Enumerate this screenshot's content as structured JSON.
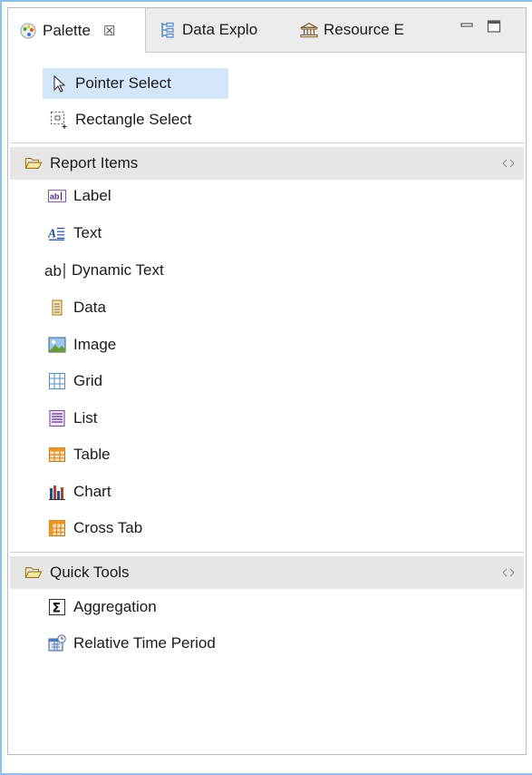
{
  "tabs": [
    {
      "label": "Palette",
      "icon": "palette-icon",
      "active": true,
      "close": "☒"
    },
    {
      "label": "Data Explo",
      "icon": "data-explorer-icon"
    },
    {
      "label": "Resource E",
      "icon": "resource-explorer-icon"
    }
  ],
  "window_controls": {
    "minimize": "minimize-icon",
    "maximize": "maximize-icon"
  },
  "tools": [
    {
      "label": "Pointer Select",
      "icon": "pointer-icon",
      "selected": true
    },
    {
      "label": "Rectangle Select",
      "icon": "rectangle-select-icon"
    }
  ],
  "report_items": {
    "title": "Report Items",
    "items": [
      {
        "label": "Label",
        "icon": "label-icon"
      },
      {
        "label": "Text",
        "icon": "text-icon"
      },
      {
        "label": "Dynamic Text",
        "icon": "dynamic-text-icon"
      },
      {
        "label": "Data",
        "icon": "data-icon"
      },
      {
        "label": "Image",
        "icon": "image-icon"
      },
      {
        "label": "Grid",
        "icon": "grid-icon"
      },
      {
        "label": "List",
        "icon": "list-icon"
      },
      {
        "label": "Table",
        "icon": "table-icon"
      },
      {
        "label": "Chart",
        "icon": "chart-icon"
      },
      {
        "label": "Cross Tab",
        "icon": "cross-tab-icon"
      }
    ]
  },
  "quick_tools": {
    "title": "Quick Tools",
    "items": [
      {
        "label": "Aggregation",
        "icon": "sigma-icon"
      },
      {
        "label": "Relative Time Period",
        "icon": "calendar-clock-icon"
      }
    ]
  },
  "colors": {
    "selection": "#d6e6fa",
    "drawer_header": "#e6e6e6",
    "frame_border": "#8fc1e8"
  }
}
